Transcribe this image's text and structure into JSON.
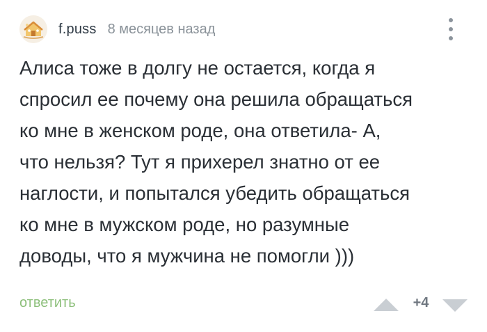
{
  "comment": {
    "author": "f.puss",
    "time": "8 месяцев назад",
    "text": "Алиса тоже в долгу не остается, когда я\nспросил ее почему она решила обращаться\nко мне в женском роде, она ответила- А,\nчто нельзя? Тут я прихерел знатно от ее\nнаглости, и попытался убедить обращаться\nко мне в мужском роде, но разумные\nдоводы, что я мужчина не помогли )))",
    "reply_label": "ответить",
    "rating": "+4"
  },
  "icons": {
    "avatar": "avatar-image",
    "more": "more-vertical-icon",
    "vote_up": "triangle-up-icon",
    "vote_down": "triangle-down-icon"
  },
  "colors": {
    "author": "#2f3a45",
    "meta": "#8a9299",
    "text": "#2a2f35",
    "reply": "#8cbf7a",
    "vote_arrows": "#c9ced3"
  }
}
